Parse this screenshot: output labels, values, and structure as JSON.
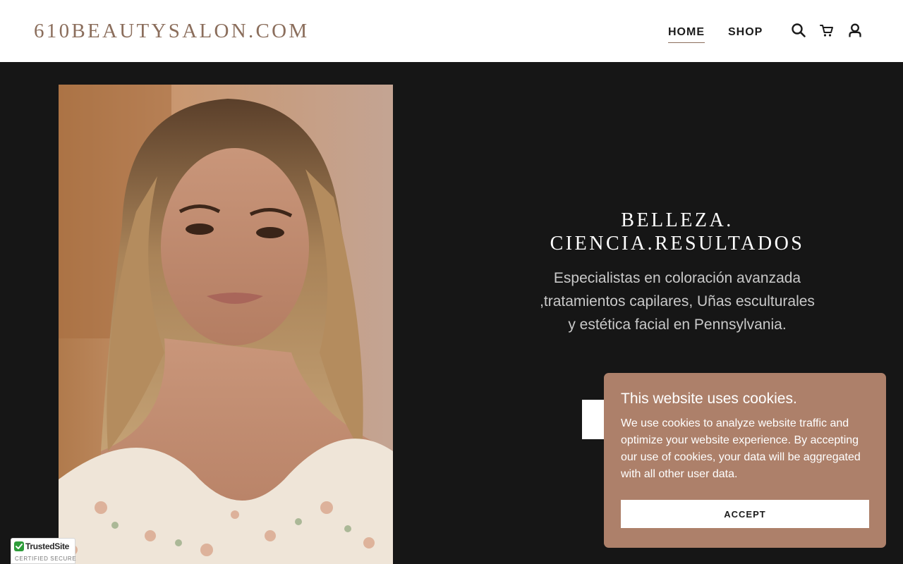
{
  "header": {
    "logo": "610BEAUTYSALON.COM",
    "nav": {
      "home": "HOME",
      "shop": "SHOP"
    },
    "icons": [
      "search-icon",
      "cart-icon",
      "user-icon"
    ]
  },
  "hero": {
    "title_line1": "BELLEZA.",
    "title_line2": "CIENCIA.RESULTADOS",
    "subtitle": "Especialistas en coloración avanzada ,tratamientos capilares, Uñas esculturales y estética facial en Pennsylvania."
  },
  "cookie_banner": {
    "title": "This website uses cookies.",
    "text": "We use cookies to analyze website traffic and optimize your website experience. By accepting our use of cookies, your data will be aggregated with all other user data.",
    "accept_label": "ACCEPT"
  },
  "trusted_badge": {
    "name": "TrustedSite",
    "subtitle": "CERTIFIED SECURE"
  },
  "colors": {
    "brand": "#8b6e5c",
    "hero_bg": "#161616",
    "cookie_bg": "#ad806a",
    "trusted_green": "#2e9d3a"
  }
}
